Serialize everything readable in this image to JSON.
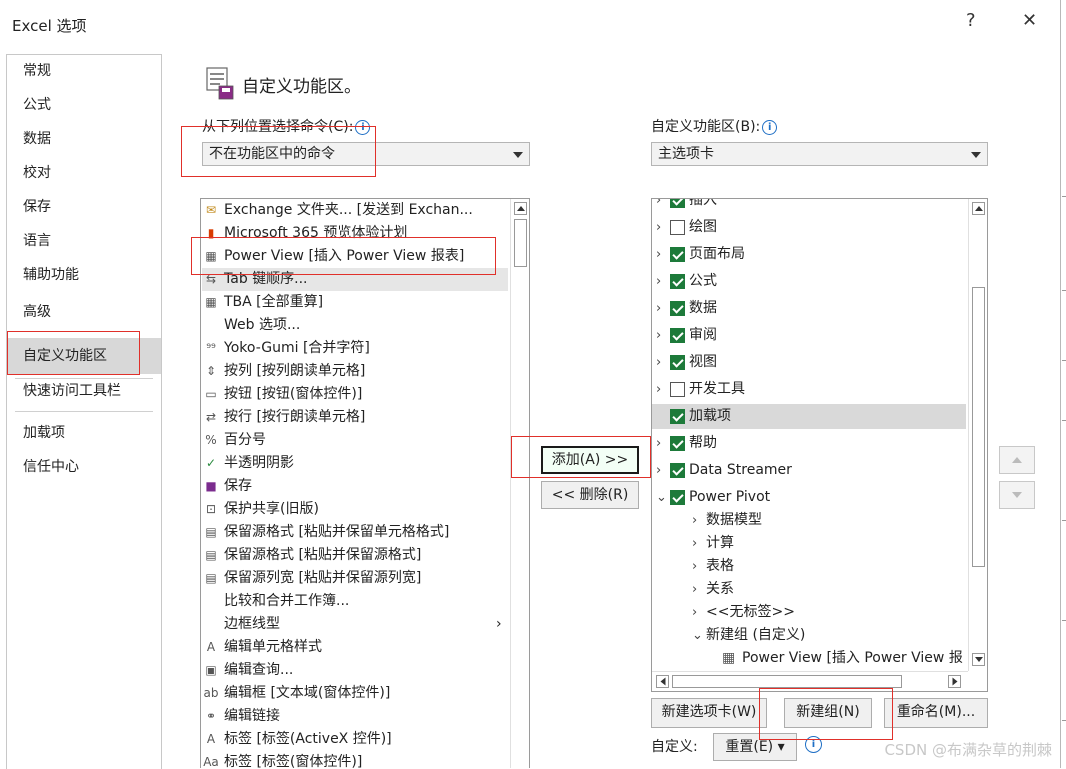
{
  "window": {
    "title": "Excel 选项",
    "help_glyph": "?",
    "close_glyph": "✕"
  },
  "nav": {
    "items": [
      "常规",
      "公式",
      "数据",
      "校对",
      "保存",
      "语言",
      "辅助功能",
      "高级",
      "自定义功能区",
      "快速访问工具栏",
      "加载项",
      "信任中心"
    ],
    "selected": "自定义功能区"
  },
  "header": {
    "title": "自定义功能区。"
  },
  "left": {
    "choose_label": "从下列位置选择命令(C):",
    "choose_value": "不在功能区中的命令",
    "commands": [
      {
        "icon": "exchange-icon",
        "glyph": "✉",
        "text": "Exchange 文件夹... [发送到 Exchan..."
      },
      {
        "icon": "office-icon",
        "glyph": "▮",
        "text": "Microsoft 365 预览体验计划"
      },
      {
        "icon": "chart-icon",
        "glyph": "▦",
        "text": "Power View [插入 Power View 报表]"
      },
      {
        "icon": "tab-order-icon",
        "glyph": "⇆",
        "text": "Tab 键顺序..."
      },
      {
        "icon": "calculator-icon",
        "glyph": "▦",
        "text": "TBA [全部重算]"
      },
      {
        "icon": "none",
        "glyph": "",
        "text": "Web 选项..."
      },
      {
        "icon": "yoko-icon",
        "glyph": "⁹⁹",
        "text": "Yoko-Gumi [合并字符]"
      },
      {
        "icon": "columns-icon",
        "glyph": "⇕",
        "text": "按列 [按列朗读单元格]"
      },
      {
        "icon": "button-icon",
        "glyph": "▭",
        "text": "按钮 [按钮(窗体控件)]"
      },
      {
        "icon": "rows-icon",
        "glyph": "⇄",
        "text": "按行 [按行朗读单元格]"
      },
      {
        "icon": "percent-icon",
        "glyph": "%",
        "text": "百分号"
      },
      {
        "icon": "check-icon",
        "glyph": "✓",
        "text": "半透明阴影"
      },
      {
        "icon": "save-icon",
        "glyph": "■",
        "text": "保存"
      },
      {
        "icon": "lock-icon",
        "glyph": "⊡",
        "text": "保护共享(旧版)"
      },
      {
        "icon": "paste-icon",
        "glyph": "▤",
        "text": "保留源格式 [粘贴并保留单元格格式]"
      },
      {
        "icon": "paste-icon",
        "glyph": "▤",
        "text": "保留源格式 [粘贴并保留源格式]"
      },
      {
        "icon": "paste-icon",
        "glyph": "▤",
        "text": "保留源列宽 [粘贴并保留源列宽]"
      },
      {
        "icon": "none",
        "glyph": "",
        "text": "比较和合并工作簿..."
      },
      {
        "icon": "none",
        "glyph": "",
        "text": "边框线型"
      },
      {
        "icon": "cell-style-icon",
        "glyph": "A",
        "text": "编辑单元格样式"
      },
      {
        "icon": "query-icon",
        "glyph": "▣",
        "text": "编辑查询..."
      },
      {
        "icon": "textbox-icon",
        "glyph": "ab",
        "text": "编辑框 [文本域(窗体控件)]"
      },
      {
        "icon": "link-icon",
        "glyph": "⚭",
        "text": "编辑链接"
      },
      {
        "icon": "label-icon",
        "glyph": "A",
        "text": "标签 [标签(ActiveX 控件)]"
      },
      {
        "icon": "label-icon",
        "glyph": "Aa",
        "text": "标签 [标签(窗体控件)]"
      }
    ],
    "submenu_glyph": "›"
  },
  "middle": {
    "add_label": "添加(A) >>",
    "remove_label": "<< 删除(R)"
  },
  "right": {
    "customize_label": "自定义功能区(B):",
    "customize_value": "主选项卡",
    "tree": [
      {
        "level": 0,
        "expand": "›",
        "checked": true,
        "text": "插入"
      },
      {
        "level": 0,
        "expand": "›",
        "checked": false,
        "text": "绘图"
      },
      {
        "level": 0,
        "expand": "›",
        "checked": true,
        "text": "页面布局"
      },
      {
        "level": 0,
        "expand": "›",
        "checked": true,
        "text": "公式"
      },
      {
        "level": 0,
        "expand": "›",
        "checked": true,
        "text": "数据"
      },
      {
        "level": 0,
        "expand": "›",
        "checked": true,
        "text": "审阅"
      },
      {
        "level": 0,
        "expand": "›",
        "checked": true,
        "text": "视图"
      },
      {
        "level": 0,
        "expand": "›",
        "checked": false,
        "text": "开发工具"
      },
      {
        "level": 0,
        "expand": "",
        "checked": true,
        "text": "加载项",
        "selected": true
      },
      {
        "level": 0,
        "expand": "›",
        "checked": true,
        "text": "帮助"
      },
      {
        "level": 0,
        "expand": "›",
        "checked": true,
        "text": "Data Streamer"
      },
      {
        "level": 0,
        "expand": "⌄",
        "checked": true,
        "text": "Power Pivot"
      },
      {
        "level": 1,
        "expand": "›",
        "text": "数据模型"
      },
      {
        "level": 1,
        "expand": "›",
        "text": "计算"
      },
      {
        "level": 1,
        "expand": "›",
        "text": "表格"
      },
      {
        "level": 1,
        "expand": "›",
        "text": "关系"
      },
      {
        "level": 1,
        "expand": "›",
        "text": "<<无标签>>"
      },
      {
        "level": 1,
        "expand": "⌄",
        "text": "新建组 (自定义)"
      },
      {
        "level": 2,
        "icon": "chart-icon",
        "text": "Power View [插入 Power View 报"
      }
    ],
    "buttons": {
      "new_tab": "新建选项卡(W)",
      "new_group": "新建组(N)",
      "rename": "重命名(M)..."
    },
    "custom_label": "自定义:",
    "reset_label": "重置(E) ▾"
  },
  "watermark": "CSDN @布满杂草的荆棘"
}
